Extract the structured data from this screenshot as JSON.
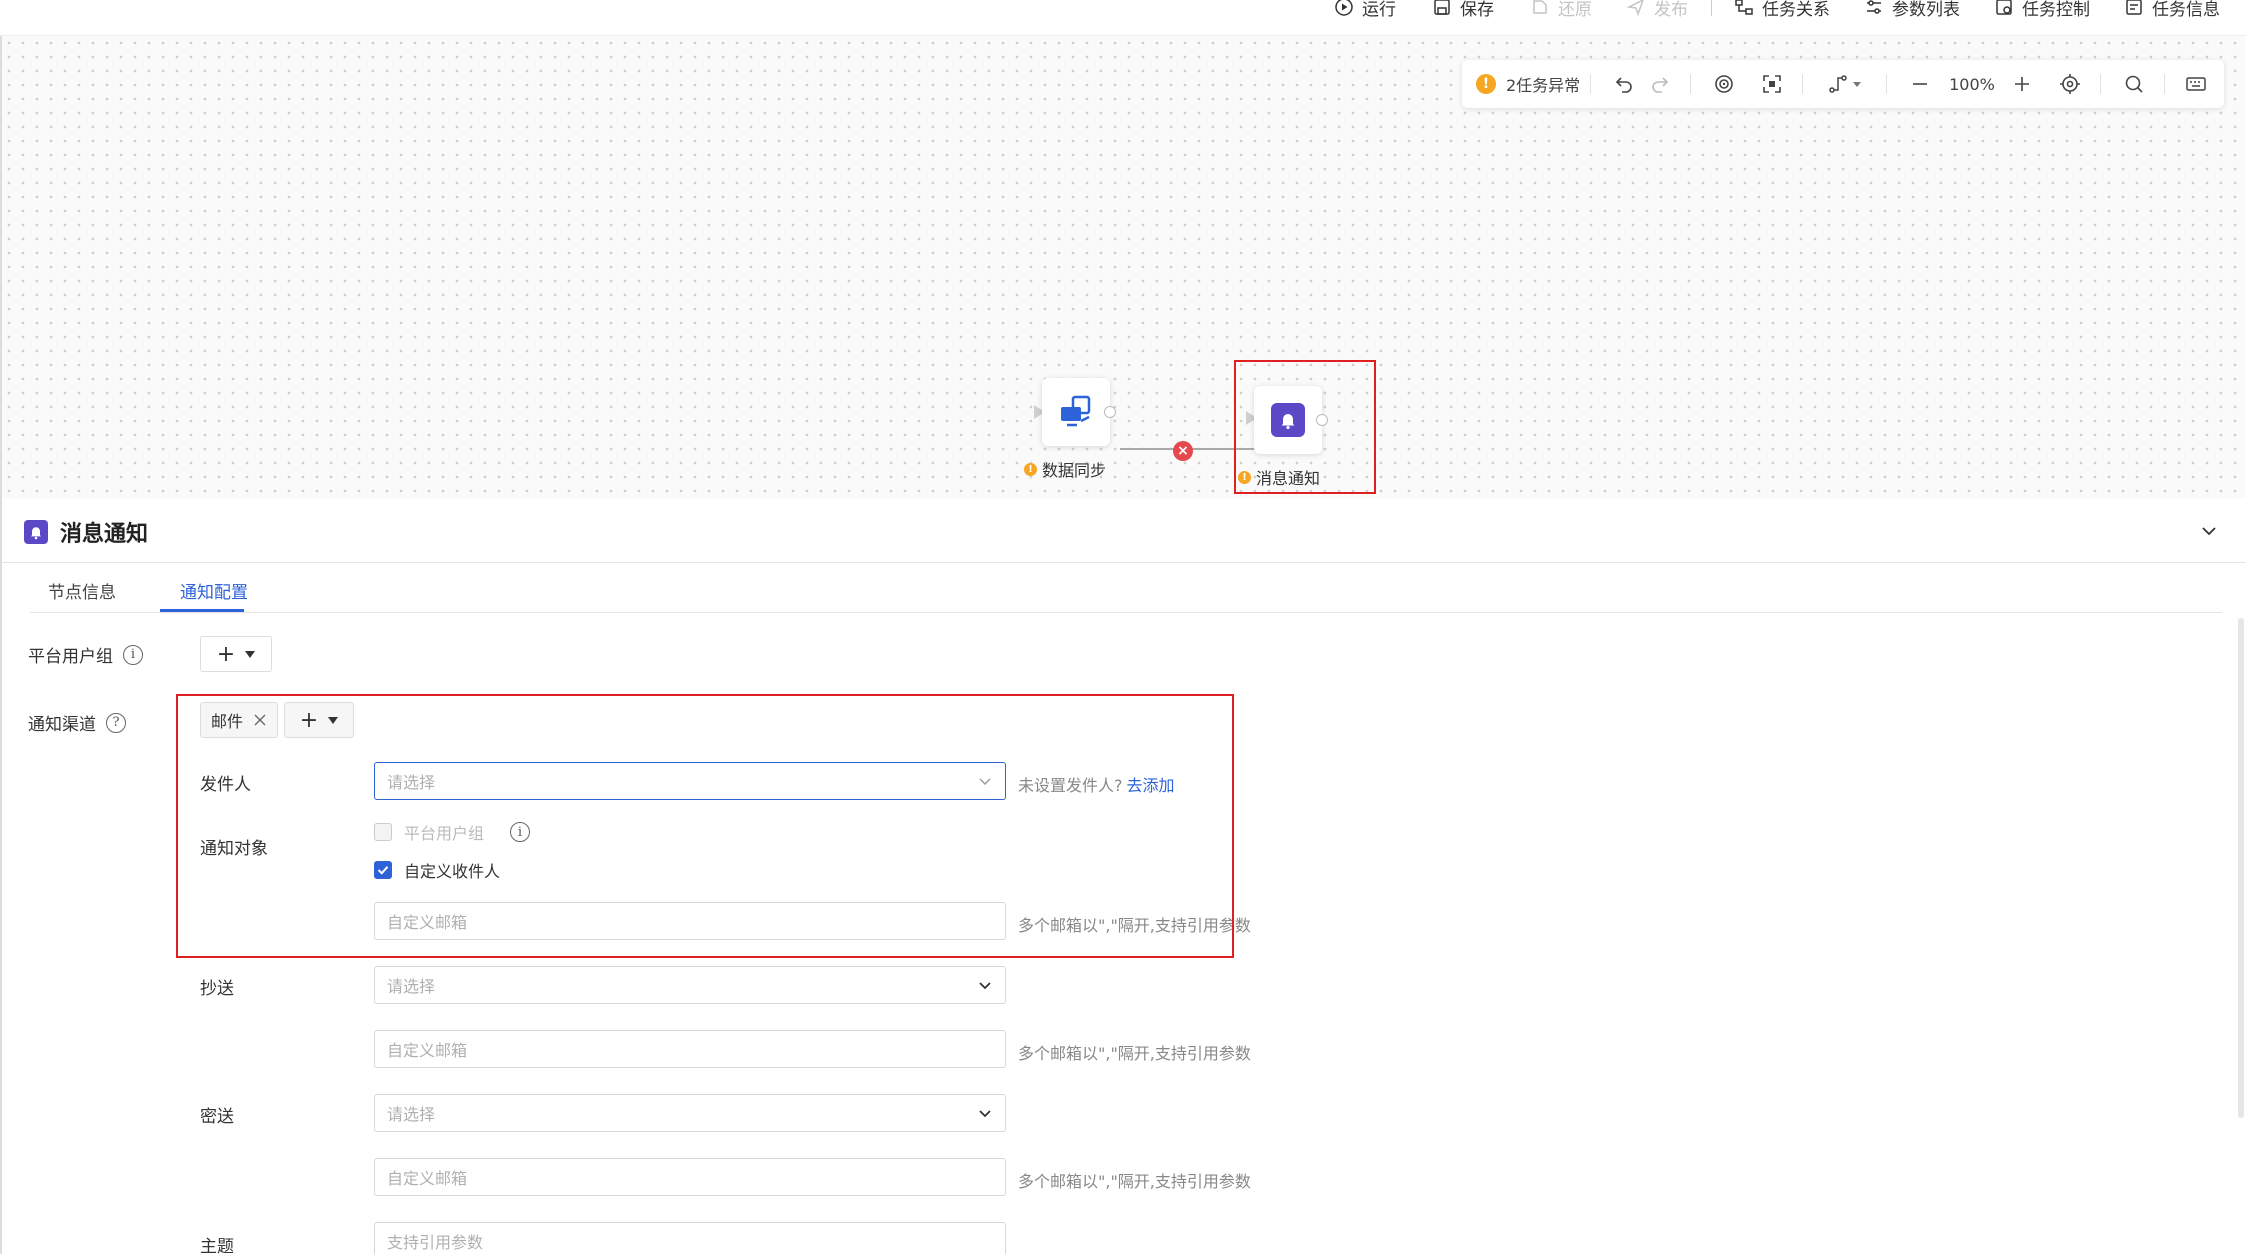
{
  "toolbar": {
    "run": "运行",
    "save": "保存",
    "restore": "还原",
    "publish": "发布",
    "task_relation": "任务关系",
    "param_list": "参数列表",
    "task_control": "任务控制",
    "task_info": "任务信息"
  },
  "canvas_toolbar": {
    "warning_count_text": "2任务异常",
    "warning_glyph": "!",
    "zoom": "100%"
  },
  "nodes": {
    "source": {
      "label": "数据同步",
      "icon": "data-sync-icon"
    },
    "target": {
      "label": "消息通知",
      "icon": "bell-icon"
    },
    "edge_status": "error"
  },
  "panel": {
    "title": "消息通知",
    "tabs": [
      {
        "label": "节点信息",
        "active": false
      },
      {
        "label": "通知配置",
        "active": true
      }
    ]
  },
  "form": {
    "platform_user_group_label": "平台用户组",
    "notify_channel_label": "通知渠道",
    "channel_chip": "邮件",
    "sender_label": "发件人",
    "sender_placeholder": "请选择",
    "sender_hint": "未设置发件人?",
    "sender_hint_link": "去添加",
    "notify_target_label": "通知对象",
    "target_option_platform": "平台用户组",
    "target_option_custom": "自定义收件人",
    "target_option_custom_checked": true,
    "custom_email_placeholder": "自定义邮箱",
    "email_hint": "多个邮箱以\",\"隔开,支持引用参数",
    "cc_label": "抄送",
    "cc_placeholder": "请选择",
    "cc_email_placeholder": "自定义邮箱",
    "bcc_label": "密送",
    "bcc_placeholder": "请选择",
    "bcc_email_placeholder": "自定义邮箱",
    "subject_label": "主题",
    "subject_placeholder": "支持引用参数"
  },
  "colors": {
    "accent": "#2e62d9",
    "notify_node": "#5a48c7",
    "warning": "#f5a623",
    "error": "#e5484d",
    "highlight_box": "#e02020"
  }
}
